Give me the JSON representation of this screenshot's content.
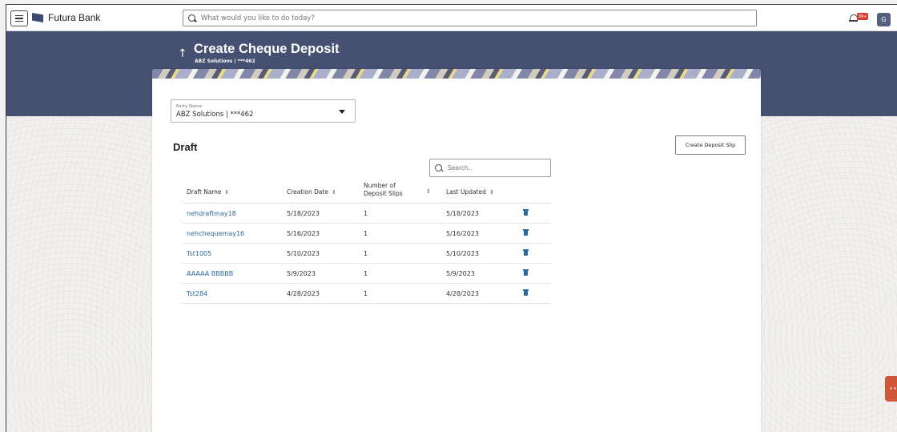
{
  "topbar": {
    "brand": "Futura Bank",
    "search_placeholder": "What would you like to do today?",
    "notification_badge": "99+",
    "avatar_initial": "G"
  },
  "header": {
    "title": "Create Cheque Deposit",
    "subtitle": "ABZ Solutions | ***462"
  },
  "party": {
    "label": "Party Name",
    "value": "ABZ Solutions | ***462"
  },
  "draft": {
    "heading": "Draft",
    "create_button": "Create Deposit Slip",
    "search_placeholder": "Search..",
    "columns": {
      "name": "Draft Name",
      "date": "Creation Date",
      "slips_line1": "Number of",
      "slips_line2": "Deposit Slips",
      "updated": "Last Updated"
    },
    "rows": [
      {
        "name": "nehdraftmay18",
        "date": "5/18/2023",
        "slips": "1",
        "updated": "5/18/2023"
      },
      {
        "name": "nehchequemay16",
        "date": "5/16/2023",
        "slips": "1",
        "updated": "5/16/2023"
      },
      {
        "name": "Tst1005",
        "date": "5/10/2023",
        "slips": "1",
        "updated": "5/10/2023"
      },
      {
        "name": "AAAAA BBBBB",
        "date": "5/9/2023",
        "slips": "1",
        "updated": "5/9/2023"
      },
      {
        "name": "Tst284",
        "date": "4/28/2023",
        "slips": "1",
        "updated": "4/28/2023"
      }
    ]
  },
  "colors": {
    "header_band": "#465071",
    "link": "#2b6a9e",
    "chat_fab": "#d2553a",
    "badge": "#d43e2f"
  },
  "icons": [
    "menu-icon",
    "bank-logo-icon",
    "search-icon",
    "bell-icon",
    "sort-icon",
    "trash-icon",
    "chat-icon",
    "caret-down-icon",
    "back-arrow-icon"
  ]
}
